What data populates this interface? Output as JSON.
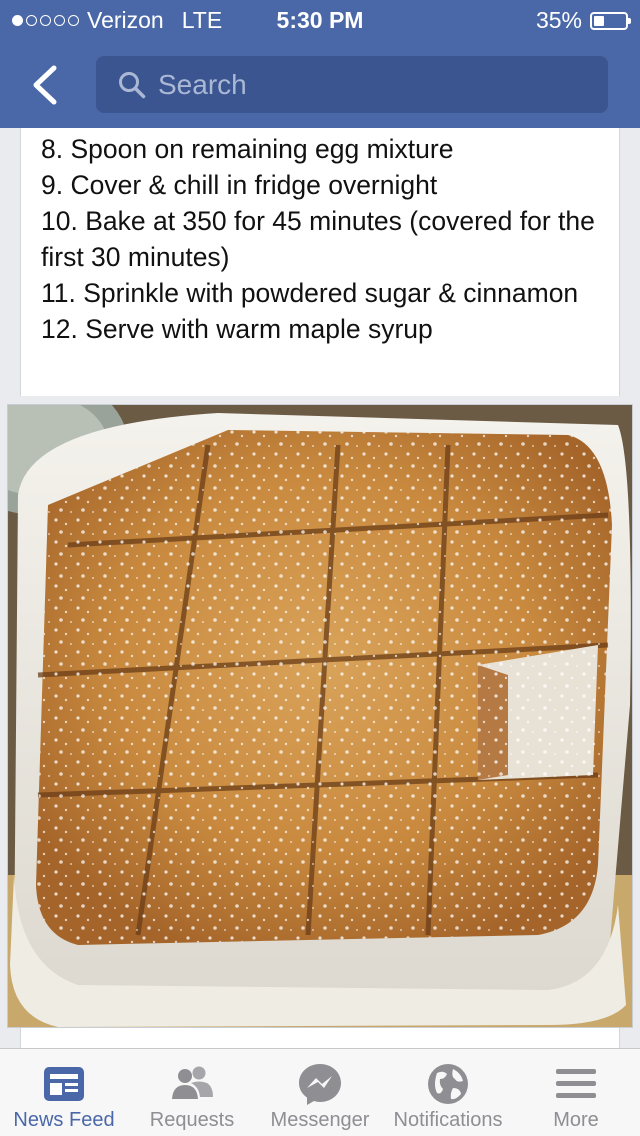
{
  "status_bar": {
    "carrier": "Verizon",
    "network": "LTE",
    "time": "5:30 PM",
    "battery": "35%",
    "battery_level": 0.35,
    "signal_bars_filled": 1,
    "signal_bars_total": 5
  },
  "nav": {
    "back_icon": "chevron-left-icon",
    "search_placeholder": "Search",
    "search_icon": "search-icon"
  },
  "post": {
    "steps": [
      " 8. Spoon on remaining egg mixture",
      " 9. Cover & chill in fridge overnight",
      " 10. Bake at 350 for 45 minutes (covered for the first 30 minutes)",
      " 11. Sprinkle with powdered sugar & cinnamon",
      " 12. Serve with warm maple syrup"
    ]
  },
  "tabs": [
    {
      "label": "News Feed",
      "icon": "news-feed-icon",
      "active": true
    },
    {
      "label": "Requests",
      "icon": "friends-icon",
      "active": false
    },
    {
      "label": "Messenger",
      "icon": "messenger-icon",
      "active": false
    },
    {
      "label": "Notifications",
      "icon": "globe-icon",
      "active": false
    },
    {
      "label": "More",
      "icon": "menu-icon",
      "active": false
    }
  ],
  "colors": {
    "brand_blue": "#4a68a8",
    "search_bg": "#3b5590",
    "tab_inactive": "#8e8e93"
  }
}
